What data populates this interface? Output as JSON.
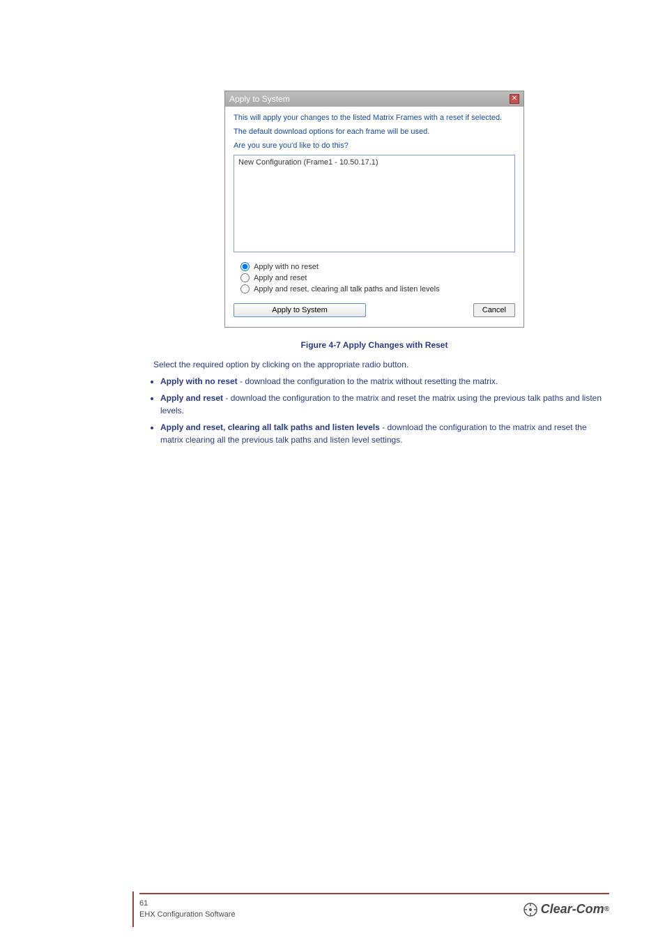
{
  "dialog": {
    "title": "Apply to System",
    "line1": "This will apply your changes to the listed Matrix Frames with a reset if selected.",
    "line2": "The default download options for each frame will be used.",
    "line3": "Are you sure you'd like to do this?",
    "list_item": "New Configuration (Frame1 - 10.50.17.1)",
    "radio1": "Apply with no reset",
    "radio2": "Apply and reset",
    "radio3": "Apply and reset, clearing all talk paths and listen levels",
    "apply_btn": "Apply to System",
    "cancel_btn": "Cancel",
    "close_glyph": "✕"
  },
  "caption": "Figure 4-7 Apply Changes with Reset",
  "instr_lead": "Select the required option by clicking on the appropriate radio button.",
  "bullets": {
    "b1a": "Apply with no reset",
    "b1b": " - download the configuration to the matrix without resetting the matrix.",
    "b2a": "Apply and reset",
    "b2b": " - download the configuration to the matrix and reset the matrix using the previous talk paths and listen levels.",
    "b3a": "Apply and reset, clearing all talk paths and listen levels",
    "b3b": " - download the configuration to the matrix and reset the matrix clearing all the previous talk paths and listen level settings."
  },
  "footer": {
    "page": "61",
    "title": "EHX Configuration Software",
    "logo_text": "Clear-Com"
  }
}
